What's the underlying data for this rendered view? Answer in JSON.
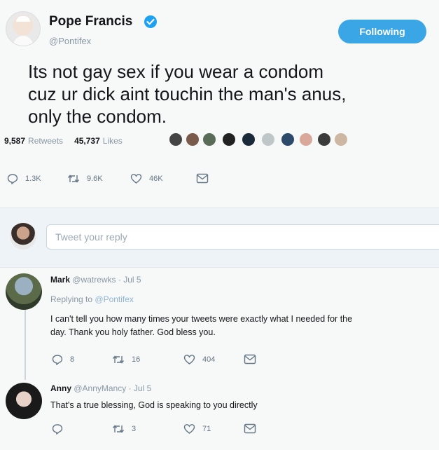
{
  "tweet": {
    "display_name": "Pope Francis",
    "handle": "@Pontifex",
    "follow_label": "Following",
    "text_lines": [
      "Its not gay sex if you wear a condom",
      "cuz ur dick aint touchin the man's anus,",
      "only the condom."
    ],
    "retweets_count": "9,587",
    "retweets_label": "Retweets",
    "likes_count": "45,737",
    "likes_label": "Likes",
    "actions": {
      "reply": "1.3K",
      "retweet": "9.6K",
      "like": "46K"
    }
  },
  "reply_box": {
    "placeholder": "Tweet your reply"
  },
  "replies": [
    {
      "name": "Mark",
      "handle": "@watrewks",
      "date": "· Jul 5",
      "replying_prefix": "Replying to",
      "replying_handle": "@Pontifex",
      "text_line1": "I can't tell you how many times your tweets were exactly what I needed for the",
      "text_line2": "day. Thank you holy father. God bless you.",
      "actions": {
        "reply": "8",
        "retweet": "16",
        "like": "404"
      }
    },
    {
      "name": "Anny",
      "handle": "@AnnyMancy",
      "date": "· Jul 5",
      "text": "That's a true blessing, God is speaking to you directly",
      "actions": {
        "reply": "",
        "retweet": "3",
        "like": "71"
      }
    }
  ],
  "colors": {
    "accent": "#1da1f2",
    "verified": "#1da1f2",
    "text": "#14171a",
    "muted": "#8899a6"
  }
}
